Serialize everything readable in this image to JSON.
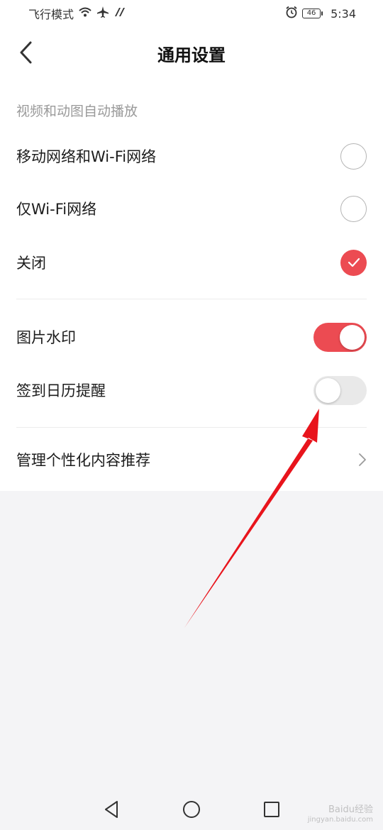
{
  "status_bar": {
    "carrier_text": "飞行模式",
    "battery": "46",
    "time": "5:34"
  },
  "header": {
    "title": "通用设置"
  },
  "autoplay": {
    "section_label": "视频和动图自动播放",
    "options": [
      {
        "label": "移动网络和Wi-Fi网络",
        "checked": false
      },
      {
        "label": "仅Wi-Fi网络",
        "checked": false
      },
      {
        "label": "关闭",
        "checked": true
      }
    ]
  },
  "toggles": [
    {
      "label": "图片水印",
      "on": true
    },
    {
      "label": "签到日历提醒",
      "on": false
    }
  ],
  "manage": {
    "label": "管理个性化内容推荐"
  },
  "watermark": {
    "line1": "Baidu经验",
    "line2": "jingyan.baidu.com"
  },
  "colors": {
    "accent": "#ec4b52",
    "annotation_arrow": "#e8141c"
  }
}
